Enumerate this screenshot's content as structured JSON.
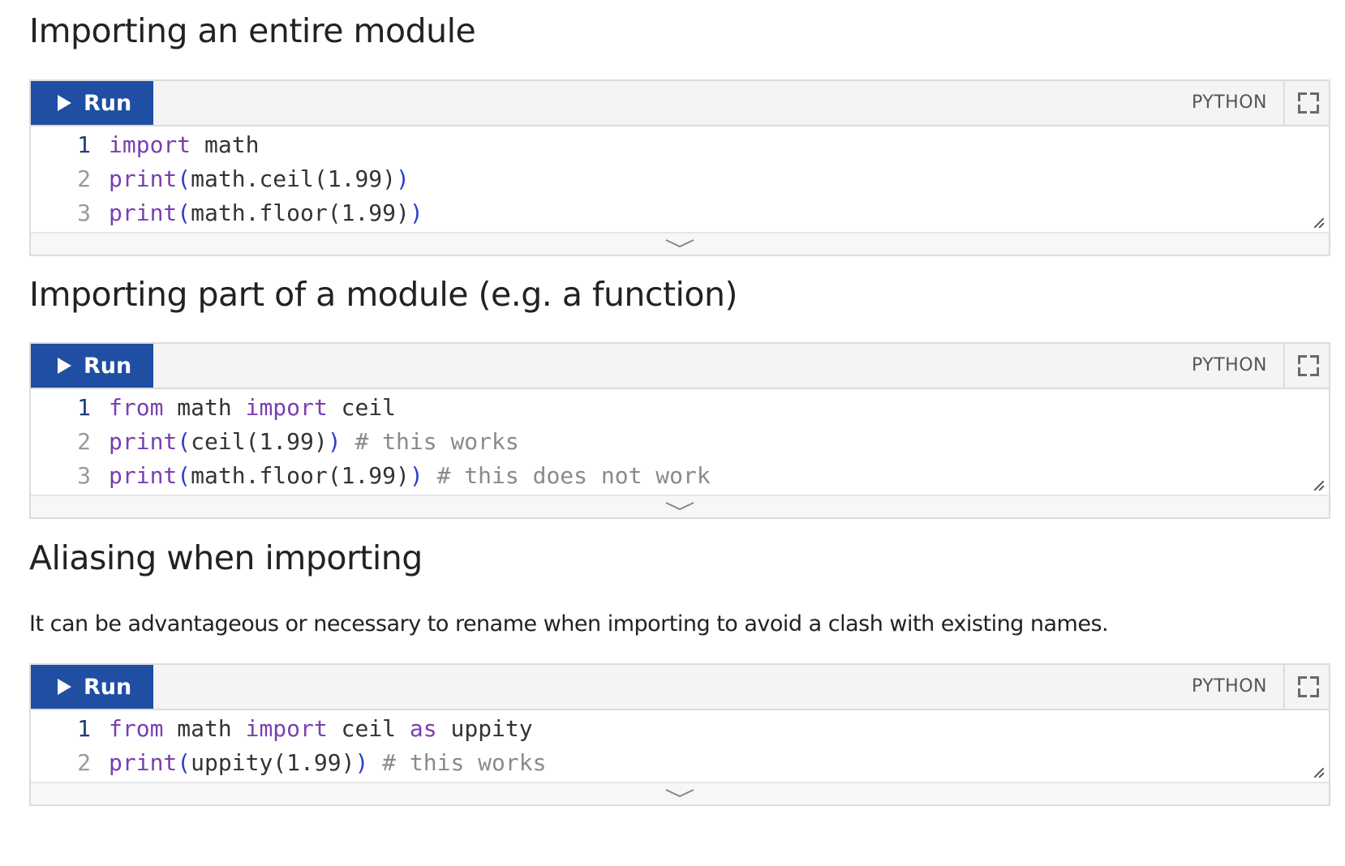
{
  "sections": [
    {
      "heading": "Importing an entire module",
      "paragraph": "",
      "code_block": {
        "run_label": "Run",
        "language": "PYTHON",
        "lines": [
          {
            "num": "1",
            "tokens": [
              {
                "t": "import",
                "c": "kw"
              },
              {
                "t": " math",
                "c": ""
              }
            ]
          },
          {
            "num": "2",
            "tokens": [
              {
                "t": "print",
                "c": "kw"
              },
              {
                "t": "(",
                "c": "pr"
              },
              {
                "t": "math.ceil(1.99)",
                "c": ""
              },
              {
                "t": ")",
                "c": "pr"
              }
            ]
          },
          {
            "num": "3",
            "tokens": [
              {
                "t": "print",
                "c": "kw"
              },
              {
                "t": "(",
                "c": "pr"
              },
              {
                "t": "math.floor(1.99)",
                "c": ""
              },
              {
                "t": ")",
                "c": "pr"
              }
            ]
          }
        ]
      }
    },
    {
      "heading": "Importing part of a module (e.g. a function)",
      "paragraph": "",
      "code_block": {
        "run_label": "Run",
        "language": "PYTHON",
        "lines": [
          {
            "num": "1",
            "tokens": [
              {
                "t": "from",
                "c": "kw"
              },
              {
                "t": " math ",
                "c": ""
              },
              {
                "t": "import",
                "c": "kw"
              },
              {
                "t": " ceil",
                "c": ""
              }
            ]
          },
          {
            "num": "2",
            "tokens": [
              {
                "t": "print",
                "c": "kw"
              },
              {
                "t": "(",
                "c": "pr"
              },
              {
                "t": "ceil(1.99)",
                "c": ""
              },
              {
                "t": ")",
                "c": "pr"
              },
              {
                "t": " # this works",
                "c": "cm"
              }
            ]
          },
          {
            "num": "3",
            "tokens": [
              {
                "t": "print",
                "c": "kw"
              },
              {
                "t": "(",
                "c": "pr"
              },
              {
                "t": "math.floor(1.99)",
                "c": ""
              },
              {
                "t": ")",
                "c": "pr"
              },
              {
                "t": " # this does not work",
                "c": "cm"
              }
            ]
          }
        ]
      }
    },
    {
      "heading": "Aliasing when importing",
      "paragraph": "It can be advantageous or necessary to rename when importing to avoid a clash with existing names.",
      "code_block": {
        "run_label": "Run",
        "language": "PYTHON",
        "lines": [
          {
            "num": "1",
            "tokens": [
              {
                "t": "from",
                "c": "kw"
              },
              {
                "t": " math ",
                "c": ""
              },
              {
                "t": "import",
                "c": "kw"
              },
              {
                "t": " ceil ",
                "c": ""
              },
              {
                "t": "as",
                "c": "kw"
              },
              {
                "t": " uppity",
                "c": ""
              }
            ]
          },
          {
            "num": "2",
            "tokens": [
              {
                "t": "print",
                "c": "kw"
              },
              {
                "t": "(",
                "c": "pr"
              },
              {
                "t": "uppity(1.99)",
                "c": ""
              },
              {
                "t": ")",
                "c": "pr"
              },
              {
                "t": " # this works",
                "c": "cm"
              }
            ]
          }
        ]
      }
    }
  ],
  "icons": {
    "run": "play-icon",
    "fullscreen": "fullscreen-icon",
    "resize": "resize-handle-icon",
    "expand": "chevron-down-icon"
  },
  "colors": {
    "run_button": "#1f4ea3",
    "keyword": "#7a3fb0",
    "paren": "#2a40c9",
    "comment": "#8a8a8a",
    "line_number": "#9a9a9a",
    "toolbar_bg": "#f4f4f4",
    "border": "#dcdcdc"
  }
}
